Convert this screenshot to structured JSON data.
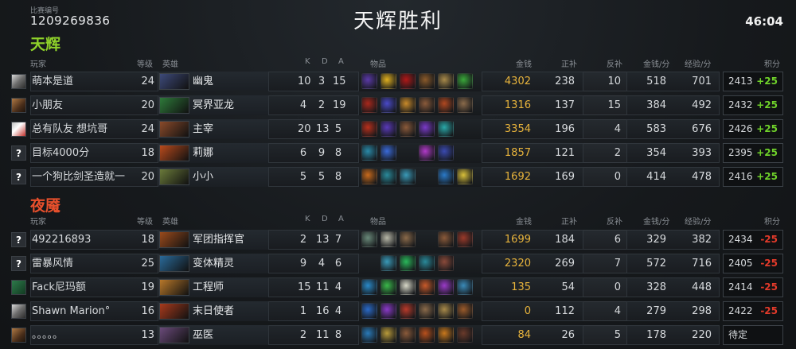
{
  "match": {
    "id_label": "比赛编号",
    "id": "1209269836",
    "result": "天辉胜利",
    "duration": "46:04"
  },
  "headers": {
    "player": "玩家",
    "level": "等级",
    "hero": "英雄",
    "k": "K",
    "d": "D",
    "a": "A",
    "items": "物品",
    "gold": "金钱",
    "last_hits": "正补",
    "denies": "反补",
    "gpm": "金钱/分",
    "xpm": "经验/分",
    "rating": "积分"
  },
  "radiant": {
    "name": "天辉",
    "players": [
      {
        "avatar": "",
        "name": "萌本是道",
        "level": "24",
        "hero": "幽鬼",
        "hero_color": "#3d4a7a",
        "k": "10",
        "d": "3",
        "a": "15",
        "items": [
          "#5b3aa8",
          "#e0b020",
          "#b01818",
          "#8a5a2a",
          "#a88a4a",
          "#3aa83a"
        ],
        "gold": "4302",
        "lh": "238",
        "dn": "10",
        "gpm": "518",
        "xpm": "701",
        "rating": "2413",
        "delta": "+25"
      },
      {
        "avatar": "",
        "name": "小朋友",
        "level": "20",
        "hero": "冥界亚龙",
        "hero_color": "#2e7a3a",
        "k": "4",
        "d": "2",
        "a": "19",
        "items": [
          "#a8281c",
          "#4a4ac8",
          "#c88a2a",
          "#8a5a3a",
          "#b04820",
          "#8a6a4a"
        ],
        "gold": "1316",
        "lh": "137",
        "dn": "15",
        "gpm": "384",
        "xpm": "492",
        "rating": "2432",
        "delta": "+25"
      },
      {
        "avatar": "",
        "name": "总有队友 想坑哥",
        "level": "24",
        "hero": "主宰",
        "hero_color": "#8a4a2a",
        "k": "20",
        "d": "13",
        "a": "5",
        "items": [
          "#b8301c",
          "#5a3ab8",
          "#8a5a3a",
          "#7a3ac8",
          "#2aa8a8",
          ""
        ],
        "gold": "3354",
        "lh": "196",
        "dn": "4",
        "gpm": "583",
        "xpm": "676",
        "rating": "2426",
        "delta": "+25"
      },
      {
        "avatar": "?",
        "name": "目标4000分",
        "level": "18",
        "hero": "莉娜",
        "hero_color": "#b84a1c",
        "k": "6",
        "d": "9",
        "a": "8",
        "items": [
          "#2a8aa8",
          "#3a6ad8",
          "",
          "#b03ac8",
          "#3a4ab0",
          ""
        ],
        "gold": "1857",
        "lh": "121",
        "dn": "2",
        "gpm": "354",
        "xpm": "393",
        "rating": "2395",
        "delta": "+25"
      },
      {
        "avatar": "?",
        "name": "一个狗比剑圣造就一",
        "level": "20",
        "hero": "小小",
        "hero_color": "#6a7a3a",
        "k": "5",
        "d": "5",
        "a": "8",
        "items": [
          "#c86a1c",
          "#2a8a9a",
          "#3a9ab8",
          "",
          "#2a7ac8",
          "#d8c03a"
        ],
        "gold": "1692",
        "lh": "169",
        "dn": "0",
        "gpm": "414",
        "xpm": "478",
        "rating": "2416",
        "delta": "+25"
      }
    ]
  },
  "dire": {
    "name": "夜魇",
    "players": [
      {
        "avatar": "?",
        "name": "492216893",
        "level": "18",
        "hero": "军团指挥官",
        "hero_color": "#9a4a1c",
        "k": "2",
        "d": "13",
        "a": "7",
        "items": [
          "#6a8a7a",
          "#b8b8a8",
          "#8a6a4a",
          "",
          "#8a5a3a",
          "#9a3a2a"
        ],
        "gold": "1699",
        "lh": "184",
        "dn": "6",
        "gpm": "329",
        "xpm": "382",
        "rating": "2434",
        "delta": "-25"
      },
      {
        "avatar": "?",
        "name": "雷暴风情",
        "level": "25",
        "hero": "变体精灵",
        "hero_color": "#2a6a9a",
        "k": "9",
        "d": "4",
        "a": "6",
        "items": [
          "",
          "#3a9ab8",
          "#2ab85a",
          "#2a8a9a",
          "#8a4a3a",
          ""
        ],
        "gold": "2320",
        "lh": "269",
        "dn": "7",
        "gpm": "572",
        "xpm": "716",
        "rating": "2405",
        "delta": "-25"
      },
      {
        "avatar": "",
        "name": "Fack尼玛额",
        "level": "19",
        "hero": "工程师",
        "hero_color": "#b8782a",
        "k": "15",
        "d": "11",
        "a": "4",
        "items": [
          "#2a8ac8",
          "#3ab84a",
          "#d8d8c8",
          "#c85a2a",
          "#9a3ac8",
          "#3a8ab8"
        ],
        "gold": "135",
        "lh": "54",
        "dn": "0",
        "gpm": "328",
        "xpm": "448",
        "rating": "2414",
        "delta": "-25"
      },
      {
        "avatar": "",
        "name": "Shawn Marion°",
        "level": "16",
        "hero": "末日使者",
        "hero_color": "#a83a1c",
        "k": "1",
        "d": "16",
        "a": "4",
        "items": [
          "#2a6ac8",
          "#8a3ac8",
          "#b83a2a",
          "#8a6a4a",
          "#a88a4a",
          "#9a5a2a"
        ],
        "gold": "0",
        "lh": "112",
        "dn": "4",
        "gpm": "279",
        "xpm": "298",
        "rating": "2422",
        "delta": "-25"
      },
      {
        "avatar": "",
        "name": "。。。。。",
        "level": "13",
        "hero": "巫医",
        "hero_color": "#6a4a7a",
        "k": "2",
        "d": "11",
        "a": "8",
        "items": [
          "#2a7ab8",
          "#b89a3a",
          "#8a5a3a",
          "#b8501c",
          "#c8781c",
          "#6a3a2a"
        ],
        "gold": "84",
        "lh": "26",
        "dn": "5",
        "gpm": "178",
        "xpm": "220",
        "rating": "待定",
        "delta": ""
      }
    ]
  }
}
